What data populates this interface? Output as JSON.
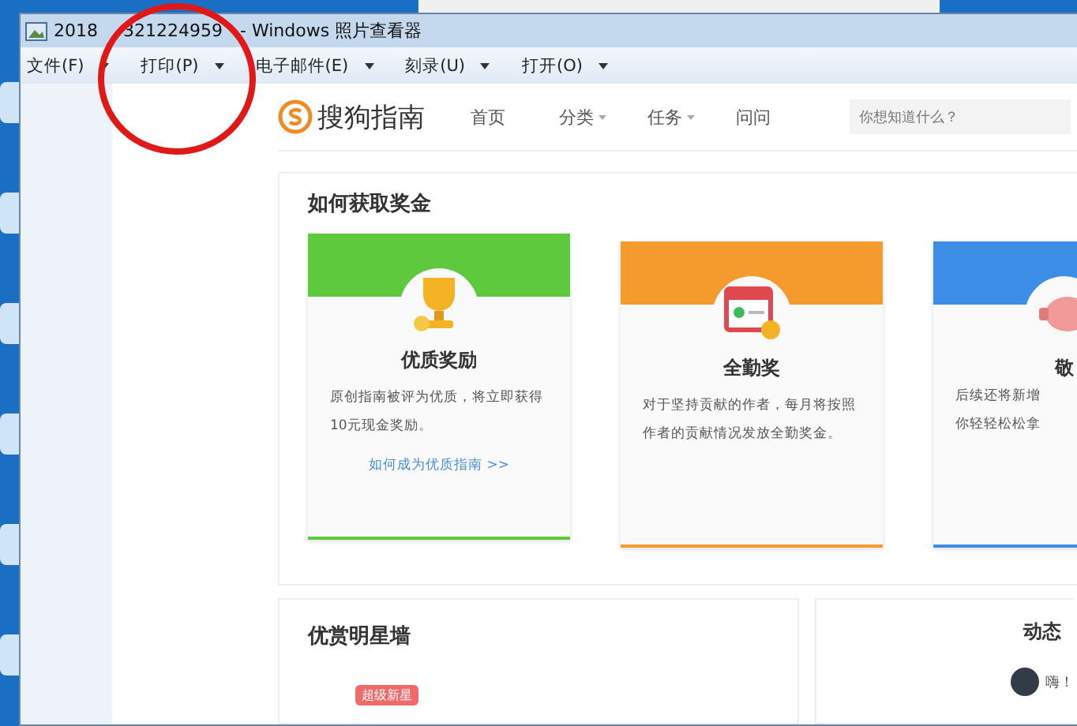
{
  "window": {
    "title_parts": [
      "2018",
      "321224959",
      "- Windows 照片查看器"
    ]
  },
  "menu": [
    {
      "label": "文件(F)"
    },
    {
      "label": "打印(P)"
    },
    {
      "label": "电子邮件(E)"
    },
    {
      "label": "刻录(U)"
    },
    {
      "label": "打开(O)"
    }
  ],
  "site": {
    "logo": "搜狗指南",
    "nav": [
      {
        "label": "首页",
        "dropdown": false
      },
      {
        "label": "分类",
        "dropdown": true
      },
      {
        "label": "任务",
        "dropdown": true
      },
      {
        "label": "问问",
        "dropdown": false
      }
    ],
    "search": {
      "placeholder": "你想知道什么？"
    }
  },
  "bonus": {
    "title": "如何获取奖金",
    "cards": [
      {
        "kind": "trophy",
        "color": "#5fc93e",
        "title": "优质奖励",
        "text": "原创指南被评为优质，将立即获得10元现金奖励。",
        "link": "如何成为优质指南 >>"
      },
      {
        "kind": "calendar",
        "color": "#f59a2c",
        "title": "全勤奖",
        "text": "对于坚持贡献的作者，每月将按照作者的贡献情况发放全勤奖金。"
      },
      {
        "kind": "piggy",
        "color": "#3d8ee6",
        "title": "敬",
        "lines": [
          "后续还将新增",
          "你轻轻松松拿"
        ]
      }
    ]
  },
  "stars": {
    "title": "优赏明星墙",
    "badge": "超级新星"
  },
  "feed": {
    "title": "动态",
    "message": "嗨！"
  }
}
